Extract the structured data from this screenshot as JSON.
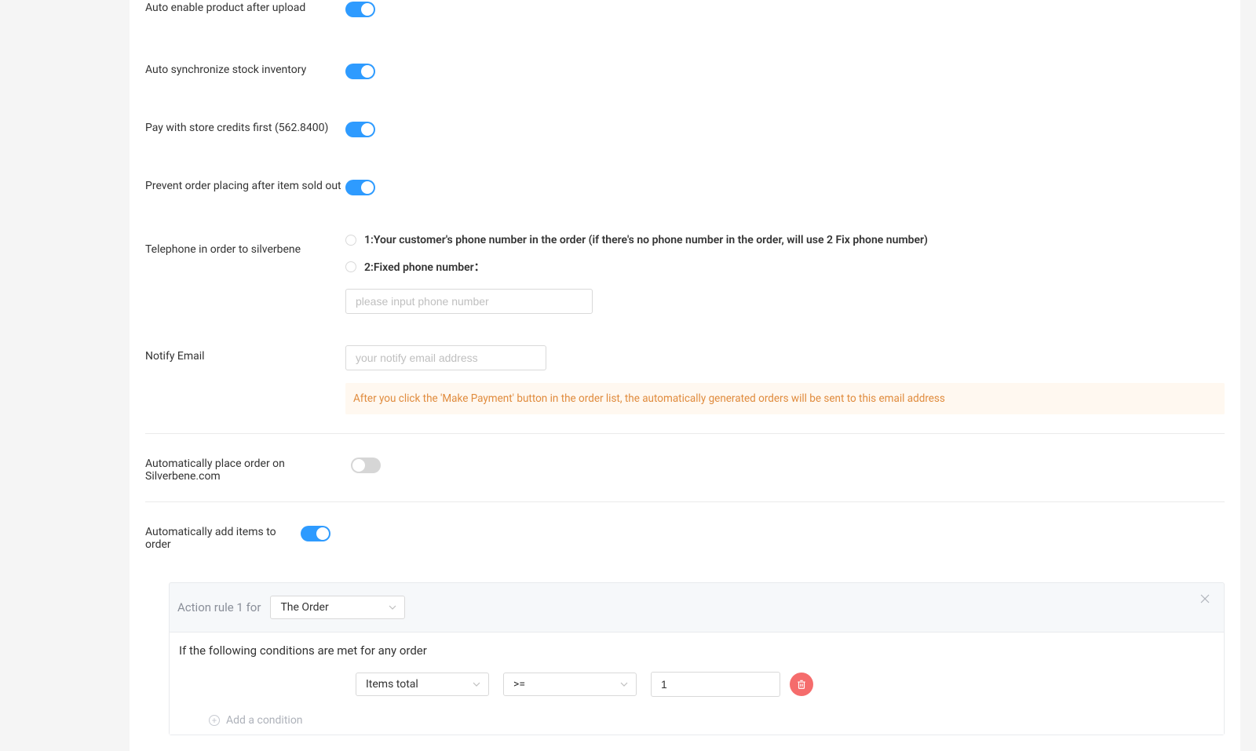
{
  "settings": {
    "auto_enable_label": "Auto enable product after upload",
    "auto_sync_label": "Auto synchronize stock inventory",
    "pay_credits_label": "Pay with store credits first (562.8400)",
    "prevent_sold_out_label": "Prevent order placing after item sold out",
    "telephone_label": "Telephone in order to silverbene",
    "telephone_opt1": "1:Your customer's phone number in the order (if there's no phone number in the order, will use 2 Fix phone number)",
    "telephone_opt2": "2:Fixed phone number：",
    "phone_placeholder": "please input phone number",
    "notify_email_label": "Notify Email",
    "email_placeholder": "your notify email address",
    "email_hint": "After you click the 'Make Payment' button in the order list, the automatically generated orders will be sent to this email address",
    "auto_place_label": "Automatically place order on Silverbene.com",
    "auto_add_label": "Automatically add items to order"
  },
  "rule": {
    "title": "Action rule 1 for",
    "target_selected": "The Order",
    "conditions_header": "If the following conditions are met for any order",
    "field_selected": "Items total",
    "operator_selected": ">=",
    "value": "1",
    "add_condition_label": "Add a condition"
  }
}
